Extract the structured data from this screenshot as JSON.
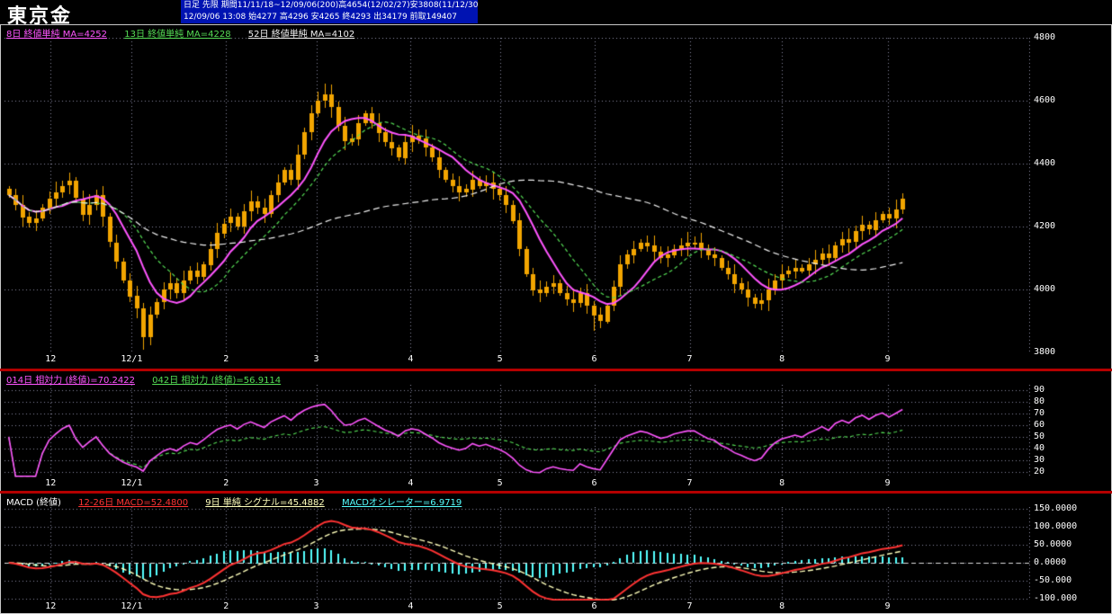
{
  "app": {
    "title": "東京金",
    "info_line1": "日足 先限 期間11/11/18~12/09/06(200)高4654(12/02/27)安3808(11/12/30)",
    "info_line2": "12/09/06 13:08 始4277 高4296 安4265 終4293 出34179 前取149407"
  },
  "colors": {
    "background": "#000000",
    "panel_border": "#c8c8c8",
    "separator_red": "#b40000",
    "info_strip_blue": "#0013b2",
    "grid": "#8a8aa0",
    "text": "#ffffff",
    "candle_orange": "#f2a500",
    "ma8_magenta": "#ff55ff",
    "ma13_green": "#55dd55",
    "ma52_white": "#f0f0f0",
    "rsi14_magenta": "#ff55ff",
    "rsi42_green": "#55dd55",
    "macd_red": "#ff3333",
    "signal_yellow": "#ffffbb",
    "histogram_cyan": "#55ffff"
  },
  "axes": {
    "data_fraction": 0.878,
    "xticks": [
      {
        "label": "12",
        "f": 0.045
      },
      {
        "label": "12/1",
        "f": 0.124
      },
      {
        "label": "2",
        "f": 0.216
      },
      {
        "label": "3",
        "f": 0.304
      },
      {
        "label": "4",
        "f": 0.396
      },
      {
        "label": "5",
        "f": 0.483
      },
      {
        "label": "6",
        "f": 0.575
      },
      {
        "label": "7",
        "f": 0.668
      },
      {
        "label": "8",
        "f": 0.758
      },
      {
        "label": "9",
        "f": 0.861
      }
    ]
  },
  "chart_data": [
    {
      "type": "candlestick",
      "name": "price",
      "title": "東京金 日足 先限",
      "ylim": [
        3800,
        4800
      ],
      "yticks": [
        {
          "label": "4800",
          "v": 4800
        },
        {
          "label": "4600",
          "v": 4600
        },
        {
          "label": "4400",
          "v": 4400
        },
        {
          "label": "4200",
          "v": 4200
        },
        {
          "label": "4000",
          "v": 4000
        },
        {
          "label": "3800",
          "v": 3800
        }
      ],
      "legend": [
        {
          "label": "8日 終値単純 MA=4252",
          "period": 8,
          "color": "#ff55ff",
          "style": "solid"
        },
        {
          "label": "13日 終値単純 MA=4228",
          "period": 13,
          "color": "#55dd55",
          "style": "dashed"
        },
        {
          "label": "52日 終値単純 MA=4102",
          "period": 52,
          "color": "#f0f0f0",
          "style": "dashed"
        }
      ],
      "period_high": {
        "value": 4654,
        "date": "12/02/27"
      },
      "period_low": {
        "value": 3808,
        "date": "11/12/30"
      },
      "session": {
        "open": 4277,
        "high": 4296,
        "low": 4265,
        "close": 4293,
        "volume": 34179,
        "prev_open_interest": 149407
      },
      "first_open": 4320,
      "wick_base": 8,
      "wick_var": 26,
      "high_overrides": {
        "46": 4630,
        "47": 4654
      },
      "low_overrides": {
        "20": 3808,
        "87": 3868,
        "111": 3940
      },
      "closes": [
        4300,
        4270,
        4230,
        4210,
        4225,
        4260,
        4290,
        4310,
        4330,
        4345,
        4290,
        4240,
        4270,
        4300,
        4230,
        4150,
        4090,
        4030,
        3980,
        3940,
        3850,
        3920,
        3960,
        4000,
        4020,
        3990,
        4030,
        4060,
        4040,
        4080,
        4130,
        4180,
        4210,
        4230,
        4200,
        4250,
        4280,
        4260,
        4240,
        4300,
        4340,
        4380,
        4350,
        4430,
        4500,
        4560,
        4600,
        4620,
        4580,
        4520,
        4470,
        4480,
        4530,
        4560,
        4530,
        4500,
        4470,
        4450,
        4420,
        4470,
        4490,
        4480,
        4450,
        4420,
        4380,
        4350,
        4330,
        4310,
        4320,
        4350,
        4330,
        4340,
        4320,
        4300,
        4270,
        4220,
        4130,
        4050,
        4000,
        3990,
        4010,
        4020,
        3990,
        3970,
        3960,
        3990,
        3950,
        3920,
        3900,
        3950,
        4010,
        4080,
        4110,
        4130,
        4150,
        4140,
        4120,
        4100,
        4110,
        4130,
        4140,
        4150,
        4150,
        4130,
        4110,
        4100,
        4070,
        4050,
        4020,
        4000,
        3975,
        3955,
        3965,
        4000,
        4030,
        4050,
        4060,
        4070,
        4060,
        4080,
        4095,
        4115,
        4100,
        4140,
        4160,
        4150,
        4185,
        4205,
        4190,
        4220,
        4240,
        4225,
        4255,
        4290
      ]
    },
    {
      "type": "line",
      "name": "rsi",
      "title": "相対力",
      "ylim": [
        15,
        95
      ],
      "yticks": [
        {
          "label": "90",
          "v": 90
        },
        {
          "label": "80",
          "v": 80
        },
        {
          "label": "70",
          "v": 70
        },
        {
          "label": "60",
          "v": 60
        },
        {
          "label": "50",
          "v": 50
        },
        {
          "label": "40",
          "v": 40
        },
        {
          "label": "30",
          "v": 30
        },
        {
          "label": "20",
          "v": 20
        }
      ],
      "legend": [
        {
          "label": "014日 相対力 (終値)=70.2422",
          "period": 14,
          "color": "#ff55ff",
          "style": "solid"
        },
        {
          "label": "042日 相対力 (終値)=56.9114",
          "period": 42,
          "color": "#55dd55",
          "style": "dashed"
        }
      ]
    },
    {
      "type": "macd",
      "name": "macd",
      "title": "MACD (終値)",
      "ylim": [
        -105,
        155
      ],
      "yticks": [
        {
          "label": "150.0000",
          "v": 150
        },
        {
          "label": "100.0000",
          "v": 100
        },
        {
          "label": "50.0000",
          "v": 50
        },
        {
          "label": "0.0000",
          "v": 0
        },
        {
          "label": "-50.000",
          "v": -50
        },
        {
          "label": "-100.000",
          "v": -100
        }
      ],
      "legend": [
        {
          "label": "MACD (終値)",
          "color": "#ffffff"
        },
        {
          "label": "12-26日 MACD=52.4800",
          "color": "#ff3333"
        },
        {
          "label": "9日 単純 シグナル=45.4882",
          "color": "#ffffbb"
        },
        {
          "label": "MACDオシレーター=6.9719",
          "color": "#55ffff"
        }
      ],
      "fast": 12,
      "slow": 26,
      "signal": 9
    }
  ]
}
